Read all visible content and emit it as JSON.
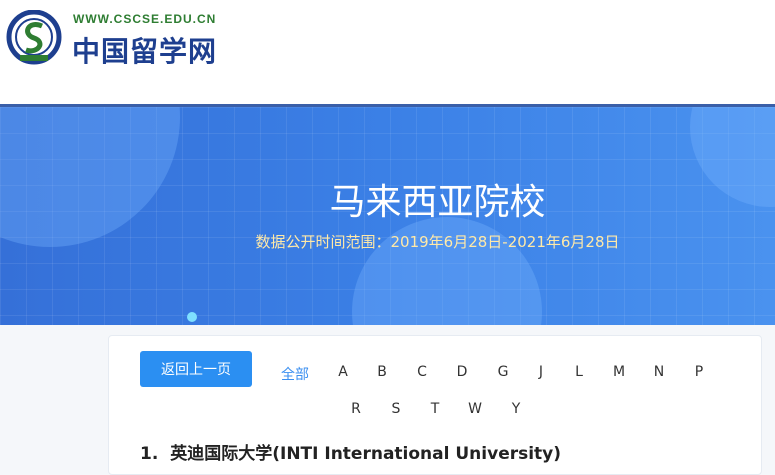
{
  "header": {
    "url": "WWW.CSCSE.EDU.CN",
    "site_name": "中国留学网"
  },
  "banner": {
    "title": "马来西亚院校",
    "subtitle": "数据公开时间范围：2019年6月28日-2021年6月28日"
  },
  "nav": {
    "back_label": "返回上一页",
    "all_label": "全部",
    "letters_row1": [
      "A",
      "B",
      "C",
      "D",
      "G",
      "J",
      "L",
      "M",
      "N",
      "P"
    ],
    "letters_row2": [
      "R",
      "S",
      "T",
      "W",
      "Y"
    ]
  },
  "list": [
    {
      "index": "1.",
      "name": "英迪国际大学(INTI International University)"
    }
  ]
}
